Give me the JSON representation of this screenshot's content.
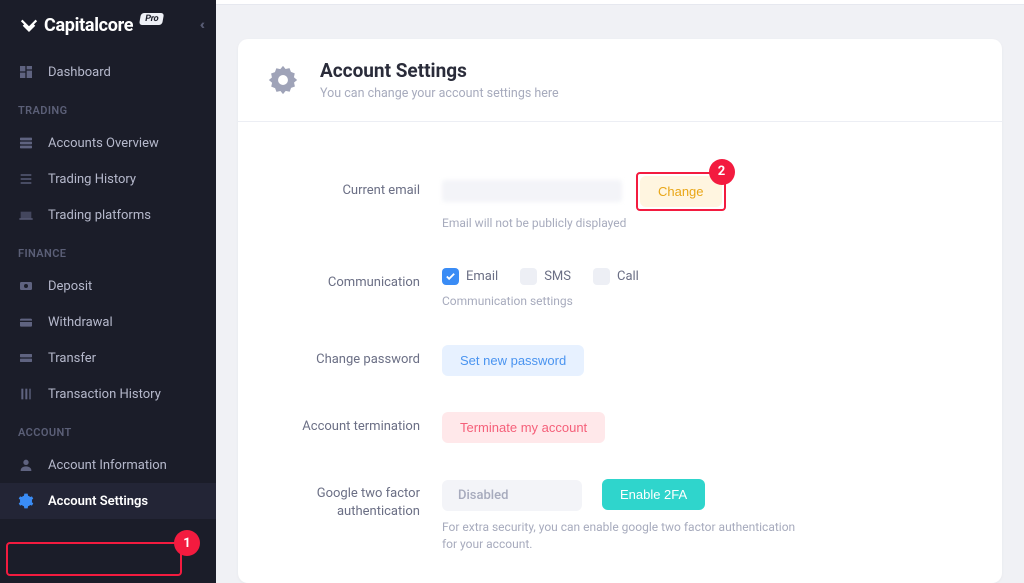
{
  "brand": {
    "name": "Capitalcore",
    "tag": "Pro"
  },
  "sidebar": {
    "items": [
      {
        "label": "Dashboard"
      }
    ],
    "trading_title": "TRADING",
    "trading": [
      {
        "label": "Accounts Overview"
      },
      {
        "label": "Trading History"
      },
      {
        "label": "Trading platforms"
      }
    ],
    "finance_title": "FINANCE",
    "finance": [
      {
        "label": "Deposit"
      },
      {
        "label": "Withdrawal"
      },
      {
        "label": "Transfer"
      },
      {
        "label": "Transaction History"
      }
    ],
    "account_title": "ACCOUNT",
    "account": [
      {
        "label": "Account Information"
      },
      {
        "label": "Account Settings"
      }
    ]
  },
  "page": {
    "title": "Account Settings",
    "subtitle": "You can change your account settings here"
  },
  "email": {
    "label": "Current email",
    "change": "Change",
    "help": "Email will not be publicly displayed"
  },
  "communication": {
    "label": "Communication",
    "opt_email": "Email",
    "opt_sms": "SMS",
    "opt_call": "Call",
    "help": "Communication settings",
    "email_checked": true,
    "sms_checked": false,
    "call_checked": false
  },
  "password": {
    "label": "Change password",
    "button": "Set new password"
  },
  "termination": {
    "label": "Account termination",
    "button": "Terminate my account"
  },
  "twofa": {
    "label": "Google two factor authentication",
    "status": "Disabled",
    "enable": "Enable 2FA",
    "help": "For extra security, you can enable google two factor authentication for your account."
  },
  "annotations": {
    "one": "1",
    "two": "2"
  }
}
